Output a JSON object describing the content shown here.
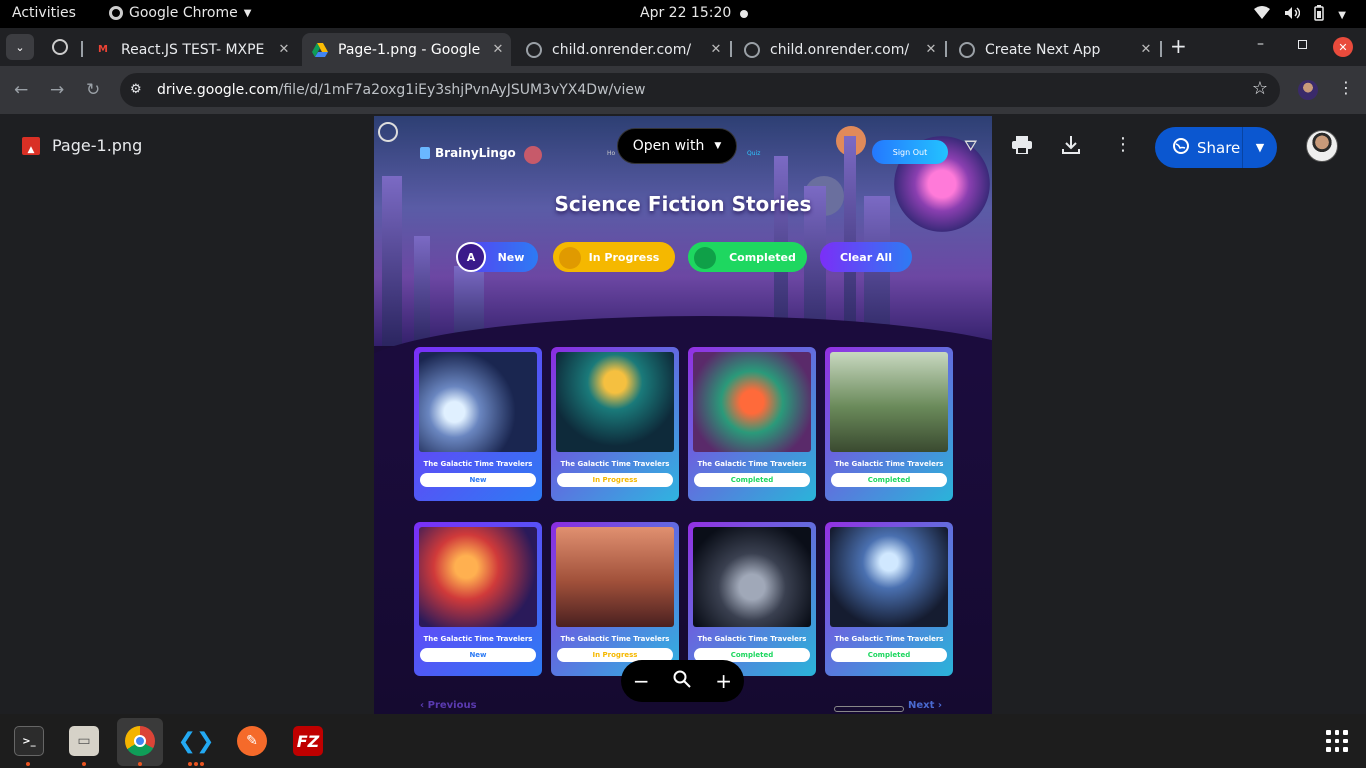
{
  "topbar": {
    "activities": "Activities",
    "app_name": "Google Chrome",
    "clock": "Apr 22  15:20"
  },
  "tabs": [
    {
      "label": "React.JS TEST- MXPE",
      "favicon": "gmail-icon"
    },
    {
      "label": "Page-1.png - Google",
      "favicon": "drive-icon",
      "active": true
    },
    {
      "label": "child.onrender.com/",
      "favicon": "globe-icon"
    },
    {
      "label": "child.onrender.com/",
      "favicon": "globe-icon"
    },
    {
      "label": "Create Next App",
      "favicon": "globe-icon"
    }
  ],
  "address": {
    "domain": "drive.google.com",
    "path": "/file/d/1mF7a2oxg1iEy3shjPvnAyJSUM3vYX4Dw/view"
  },
  "viewer": {
    "file_name": "Page-1.png",
    "open_with": "Open with",
    "share_label": "Share"
  },
  "preview": {
    "brand": "BrainyLingo",
    "hidden_nav_left": "Ho",
    "hidden_nav_right": "Quiz",
    "signout": "Sign Out",
    "heading": "Science Fiction Stories",
    "avatar_letter": "A",
    "filters": [
      "New",
      "In Progress",
      "Completed",
      "Clear All"
    ],
    "cards": [
      {
        "title": "The Galactic Time Travelers",
        "status": "New"
      },
      {
        "title": "The Galactic Time Travelers",
        "status": "In Progress"
      },
      {
        "title": "The Galactic Time Travelers",
        "status": "Completed"
      },
      {
        "title": "The Galactic Time Travelers",
        "status": "Completed"
      },
      {
        "title": "The Galactic Time Travelers",
        "status": "New"
      },
      {
        "title": "The Galactic Time Travelers",
        "status": "In Progress"
      },
      {
        "title": "The Galactic Time Travelers",
        "status": "Completed"
      },
      {
        "title": "The Galactic Time Travelers",
        "status": "Completed"
      }
    ],
    "prev": "Previous",
    "next": "Next"
  },
  "colors": {
    "new": "#2d7bf4",
    "in_progress": "#f5b800",
    "completed": "#1ed760",
    "share": "#0b57d0"
  }
}
